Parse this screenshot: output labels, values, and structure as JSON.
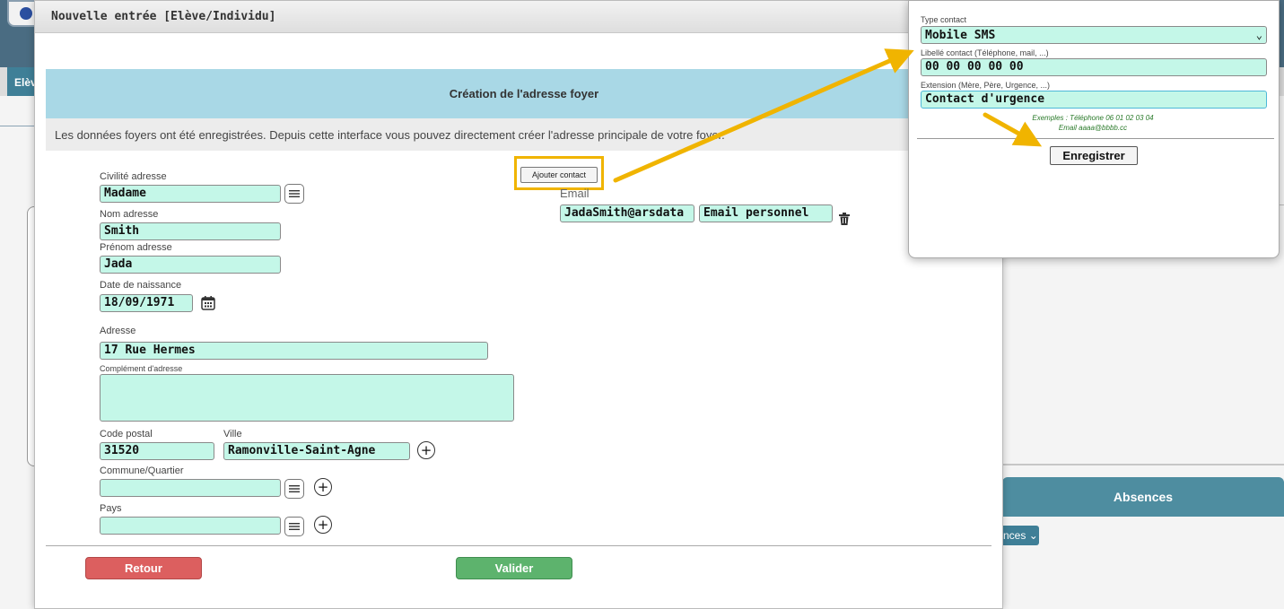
{
  "background": {
    "tab_label": "Elèv",
    "absences_label": "Absences",
    "select_fragment": "nces"
  },
  "dialog": {
    "title": "Nouvelle entrée [Elève/Individu]",
    "section_title": "Création de l'adresse foyer",
    "info_text": "Les données foyers ont été enregistrées. Depuis cette interface vous pouvez directement créer l'adresse principale de votre foyer.",
    "fields": {
      "civilite": {
        "label": "Civilité adresse",
        "value": "Madame"
      },
      "nom": {
        "label": "Nom adresse",
        "value": "Smith"
      },
      "prenom": {
        "label": "Prénom adresse",
        "value": "Jada"
      },
      "naissance": {
        "label": "Date de naissance",
        "value": "18/09/1971"
      },
      "adresse": {
        "label": "Adresse",
        "value": "17 Rue Hermes"
      },
      "complement": {
        "label": "Complément d'adresse",
        "value": ""
      },
      "code_postal": {
        "label": "Code postal",
        "value": "31520"
      },
      "ville": {
        "label": "Ville",
        "value": "Ramonville-Saint-Agne"
      },
      "commune": {
        "label": "Commune/Quartier",
        "value": ""
      },
      "pays": {
        "label": "Pays",
        "value": ""
      }
    },
    "add_contact_label": "Ajouter contact",
    "email": {
      "label": "Email",
      "value": "JadaSmith@arsdata",
      "type": "Email personnel"
    },
    "buttons": {
      "retour": "Retour",
      "valider": "Valider"
    }
  },
  "popup": {
    "type_label": "Type contact",
    "type_value": "Mobile SMS",
    "libelle_label": "Libellé contact (Téléphone, mail, ...)",
    "libelle_value": "00 00 00 00 00",
    "extension_label": "Extension (Mère, Père, Urgence, ...)",
    "extension_value": "Contact d'urgence",
    "examples_line1": "Exemples : Téléphone 06 01 02 03 04",
    "examples_line2": "Email aaaa@bbbb.cc",
    "save_label": "Enregistrer"
  },
  "colors": {
    "input_bg": "#c4f7e8",
    "header_bg": "#a9d8e6",
    "annotation": "#f0b400",
    "retour": "#dc5f5f",
    "valider": "#5db36d"
  }
}
